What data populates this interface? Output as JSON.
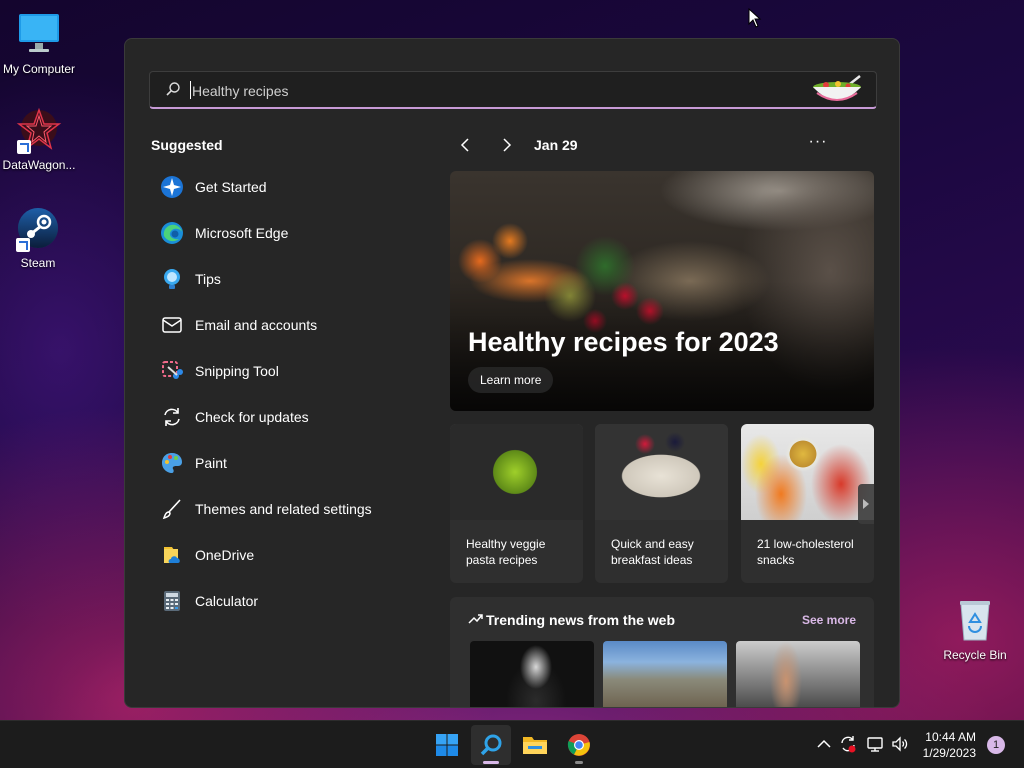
{
  "desktop": {
    "icons": [
      {
        "label": "My Computer",
        "icon": "monitor-icon"
      },
      {
        "label": "DataWagon...",
        "icon": "datawagon-icon"
      },
      {
        "label": "Steam",
        "icon": "steam-icon"
      },
      {
        "label": "Recycle Bin",
        "icon": "recycle-bin-icon"
      }
    ]
  },
  "search": {
    "query": "Healthy recipes",
    "icon": "search-icon"
  },
  "suggested": {
    "title": "Suggested",
    "items": [
      {
        "label": "Get Started",
        "icon": "get-started-icon"
      },
      {
        "label": "Microsoft Edge",
        "icon": "edge-icon"
      },
      {
        "label": "Tips",
        "icon": "tips-icon"
      },
      {
        "label": "Email and accounts",
        "icon": "mail-icon"
      },
      {
        "label": "Snipping Tool",
        "icon": "snipping-tool-icon"
      },
      {
        "label": "Check for updates",
        "icon": "refresh-icon"
      },
      {
        "label": "Paint",
        "icon": "paint-icon"
      },
      {
        "label": "Themes and related settings",
        "icon": "brush-icon"
      },
      {
        "label": "OneDrive",
        "icon": "onedrive-icon"
      },
      {
        "label": "Calculator",
        "icon": "calculator-icon"
      }
    ]
  },
  "highlights": {
    "date": "Jan 29",
    "more": "···",
    "hero": {
      "title": "Healthy recipes for 2023",
      "button": "Learn more"
    },
    "cards": [
      {
        "caption": "Healthy veggie pasta recipes"
      },
      {
        "caption": "Quick and easy breakfast ideas"
      },
      {
        "caption": "21 low-cholesterol snacks"
      }
    ],
    "trending": {
      "title": "Trending news from the web",
      "see_more": "See more"
    }
  },
  "taskbar": {
    "apps": [
      {
        "name": "start",
        "icon": "windows-logo-icon"
      },
      {
        "name": "search",
        "icon": "search-icon"
      },
      {
        "name": "file-explorer",
        "icon": "folder-icon"
      },
      {
        "name": "chrome",
        "icon": "chrome-icon"
      }
    ],
    "time": "10:44 AM",
    "date": "1/29/2023",
    "notifications": "1"
  },
  "colors": {
    "accent": "#d8b8e8",
    "panel": "#262626",
    "taskbar": "#1c1c1c"
  }
}
